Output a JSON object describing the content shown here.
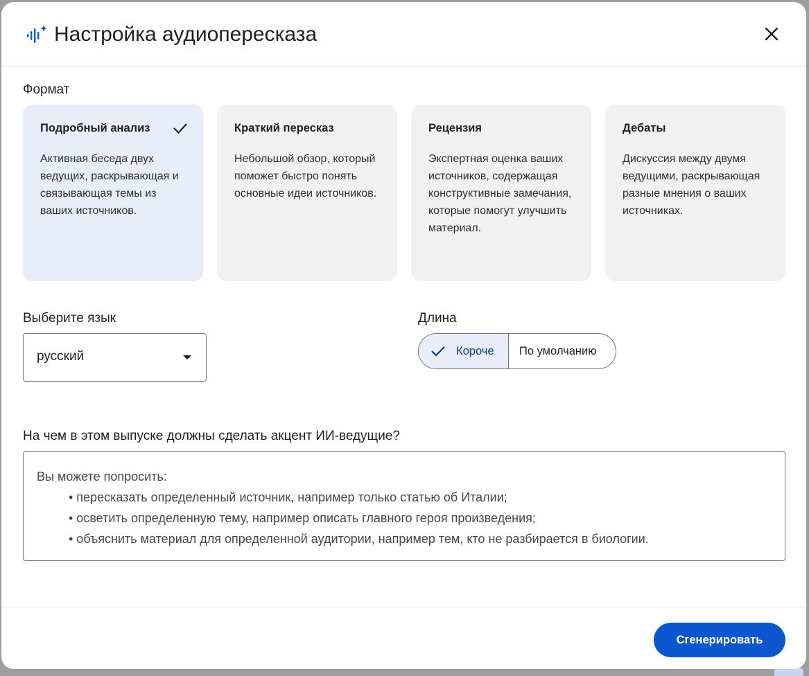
{
  "dialog": {
    "title": "Настройка аудиопересказа",
    "title_icon": "audio-spark-icon",
    "close_icon": "close-icon"
  },
  "format": {
    "label": "Формат",
    "selected_index": 0,
    "cards": [
      {
        "title": "Подробный анализ",
        "description": "Активная беседа двух ведущих, раскрывающая и связывающая темы из ваших источников."
      },
      {
        "title": "Краткий пересказ",
        "description": "Небольшой обзор, который поможет быстро понять основные идеи источников."
      },
      {
        "title": "Рецензия",
        "description": "Экспертная оценка ваших источников, содержащая конструктивные замечания, которые помогут улучшить материал."
      },
      {
        "title": "Дебаты",
        "description": "Дискуссия между двумя ведущими, раскрывающая разные мнения о ваших источниках."
      }
    ]
  },
  "language": {
    "label": "Выберите язык",
    "value": "русский"
  },
  "length": {
    "label": "Длина",
    "options": [
      "Короче",
      "По умолчанию"
    ],
    "selected": "Короче"
  },
  "focus": {
    "label": "На чем в этом выпуске должны сделать акцент ИИ-ведущие?",
    "placeholder_intro": "Вы можете попросить:",
    "placeholder_items": [
      "• пересказать определенный источник, например только статью об Италии;",
      "• осветить определенную тему, например описать главного героя произведения;",
      "• объяснить материал для определенной аудитории, например тем, кто не разбирается в биологии."
    ]
  },
  "footer": {
    "generate_label": "Сгенерировать"
  },
  "colors": {
    "primary": "#0b57d0",
    "selected_bg": "#e8edf9",
    "card_bg": "#f1f1f1",
    "title_icon": "#0b57d0"
  }
}
